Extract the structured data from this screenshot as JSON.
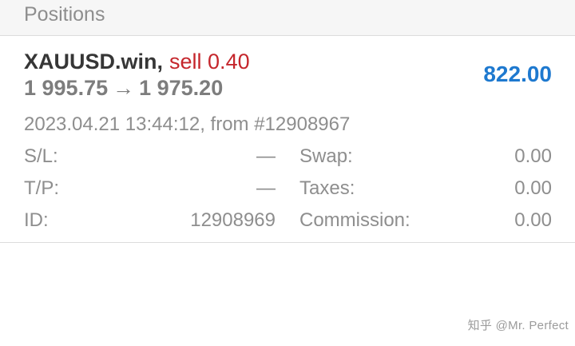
{
  "header": {
    "title": "Positions"
  },
  "position": {
    "symbol": "XAUUSD.win",
    "comma": ",",
    "side_volume": "sell 0.40",
    "open_price": "1 995.75",
    "arrow": "→",
    "current_price": "1 975.20",
    "profit": "822.00",
    "open_info": "2023.04.21 13:44:12, from #12908967",
    "details": {
      "sl": {
        "label": "S/L:",
        "value": "—"
      },
      "tp": {
        "label": "T/P:",
        "value": "—"
      },
      "id": {
        "label": "ID:",
        "value": "12908969"
      },
      "swap": {
        "label": "Swap:",
        "value": "0.00"
      },
      "taxes": {
        "label": "Taxes:",
        "value": "0.00"
      },
      "commission": {
        "label": "Commission:",
        "value": "0.00"
      }
    }
  },
  "watermark": "知乎 @Mr. Perfect",
  "colors": {
    "sell": "#c5262c",
    "profit": "#1e79cf",
    "symbol": "#363636",
    "muted": "#8e8e8e"
  }
}
